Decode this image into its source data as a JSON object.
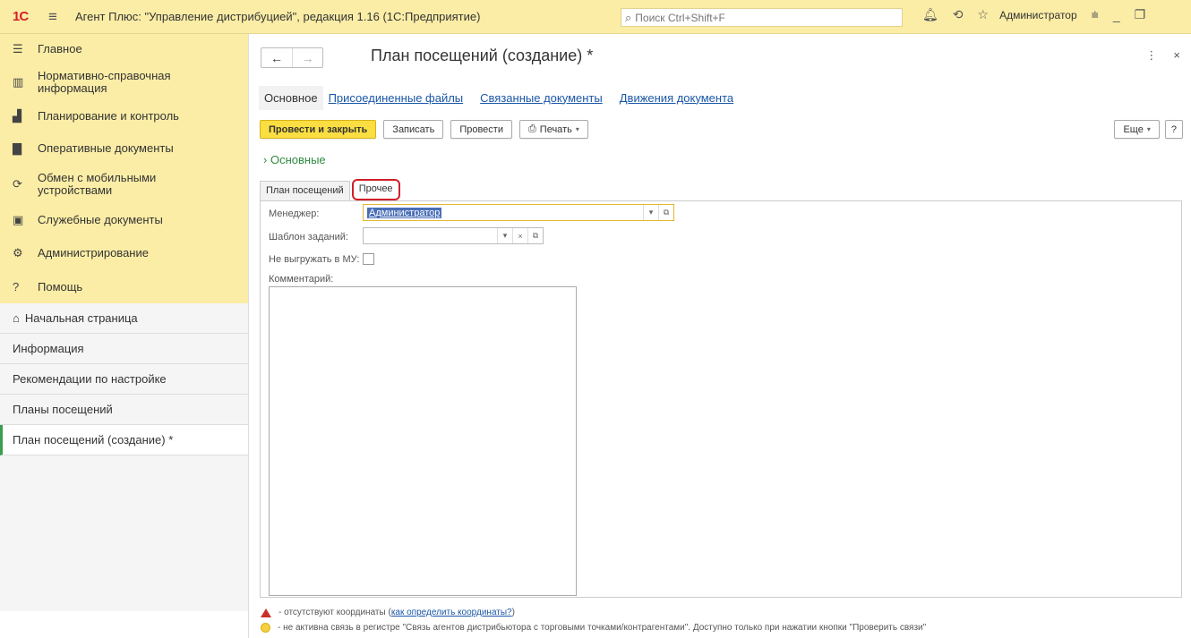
{
  "titlebar": {
    "logo": "1C",
    "app_title": "Агент Плюс: \"Управление дистрибуцией\", редакция 1.16  (1С:Предприятие)",
    "search_placeholder": "Поиск Ctrl+Shift+F",
    "user": "Администратор"
  },
  "sidebar": {
    "sections": [
      {
        "icon": "menu-icon",
        "label": "Главное"
      },
      {
        "icon": "catalog-icon",
        "label": "Нормативно-справочная информация"
      },
      {
        "icon": "chart-icon",
        "label": "Планирование и контроль"
      },
      {
        "icon": "documents-icon",
        "label": "Оперативные документы"
      },
      {
        "icon": "sync-icon",
        "label": "Обмен с мобильными устройствами"
      },
      {
        "icon": "service-docs-icon",
        "label": "Служебные документы"
      },
      {
        "icon": "gear-icon",
        "label": "Администрирование"
      },
      {
        "icon": "help-icon",
        "label": "Помощь"
      }
    ],
    "open_windows": [
      {
        "label": "Начальная страница",
        "home": true
      },
      {
        "label": "Информация"
      },
      {
        "label": "Рекомендации по настройке"
      },
      {
        "label": "Планы посещений"
      },
      {
        "label": "План посещений  (создание) *",
        "active": true
      }
    ]
  },
  "document": {
    "title": "План посещений  (создание) *",
    "tabs": [
      "Основное",
      "Присоединенные файлы",
      "Связанные документы",
      "Движения документа"
    ],
    "toolbar": {
      "post_close": "Провести и закрыть",
      "save": "Записать",
      "post": "Провести",
      "print": "Печать",
      "more": "Еще",
      "help": "?"
    },
    "section_header": "Основные",
    "inner_tabs": [
      "План посещений",
      "Прочее"
    ],
    "form": {
      "manager_label": "Менеджер:",
      "manager_value": "Администратор",
      "template_label": "Шаблон заданий:",
      "no_upload_label": "Не выгружать в МУ:",
      "comment_label": "Комментарий:"
    },
    "notes": {
      "coords_text": " - отсутствуют координаты (",
      "coords_link": "как определить координаты?",
      "coords_end": ")",
      "link_text": " - не активна связь в регистре \"Связь агентов дистрибьютора с торговыми точками/контрагентами\". Доступно только при нажатии кнопки \"Проверить связи\""
    }
  },
  "colors": {
    "header_bg": "#fbeda6",
    "primary_button": "#fbdf42",
    "section_green": "#2f8b3f",
    "link_blue": "#1a57a8"
  }
}
